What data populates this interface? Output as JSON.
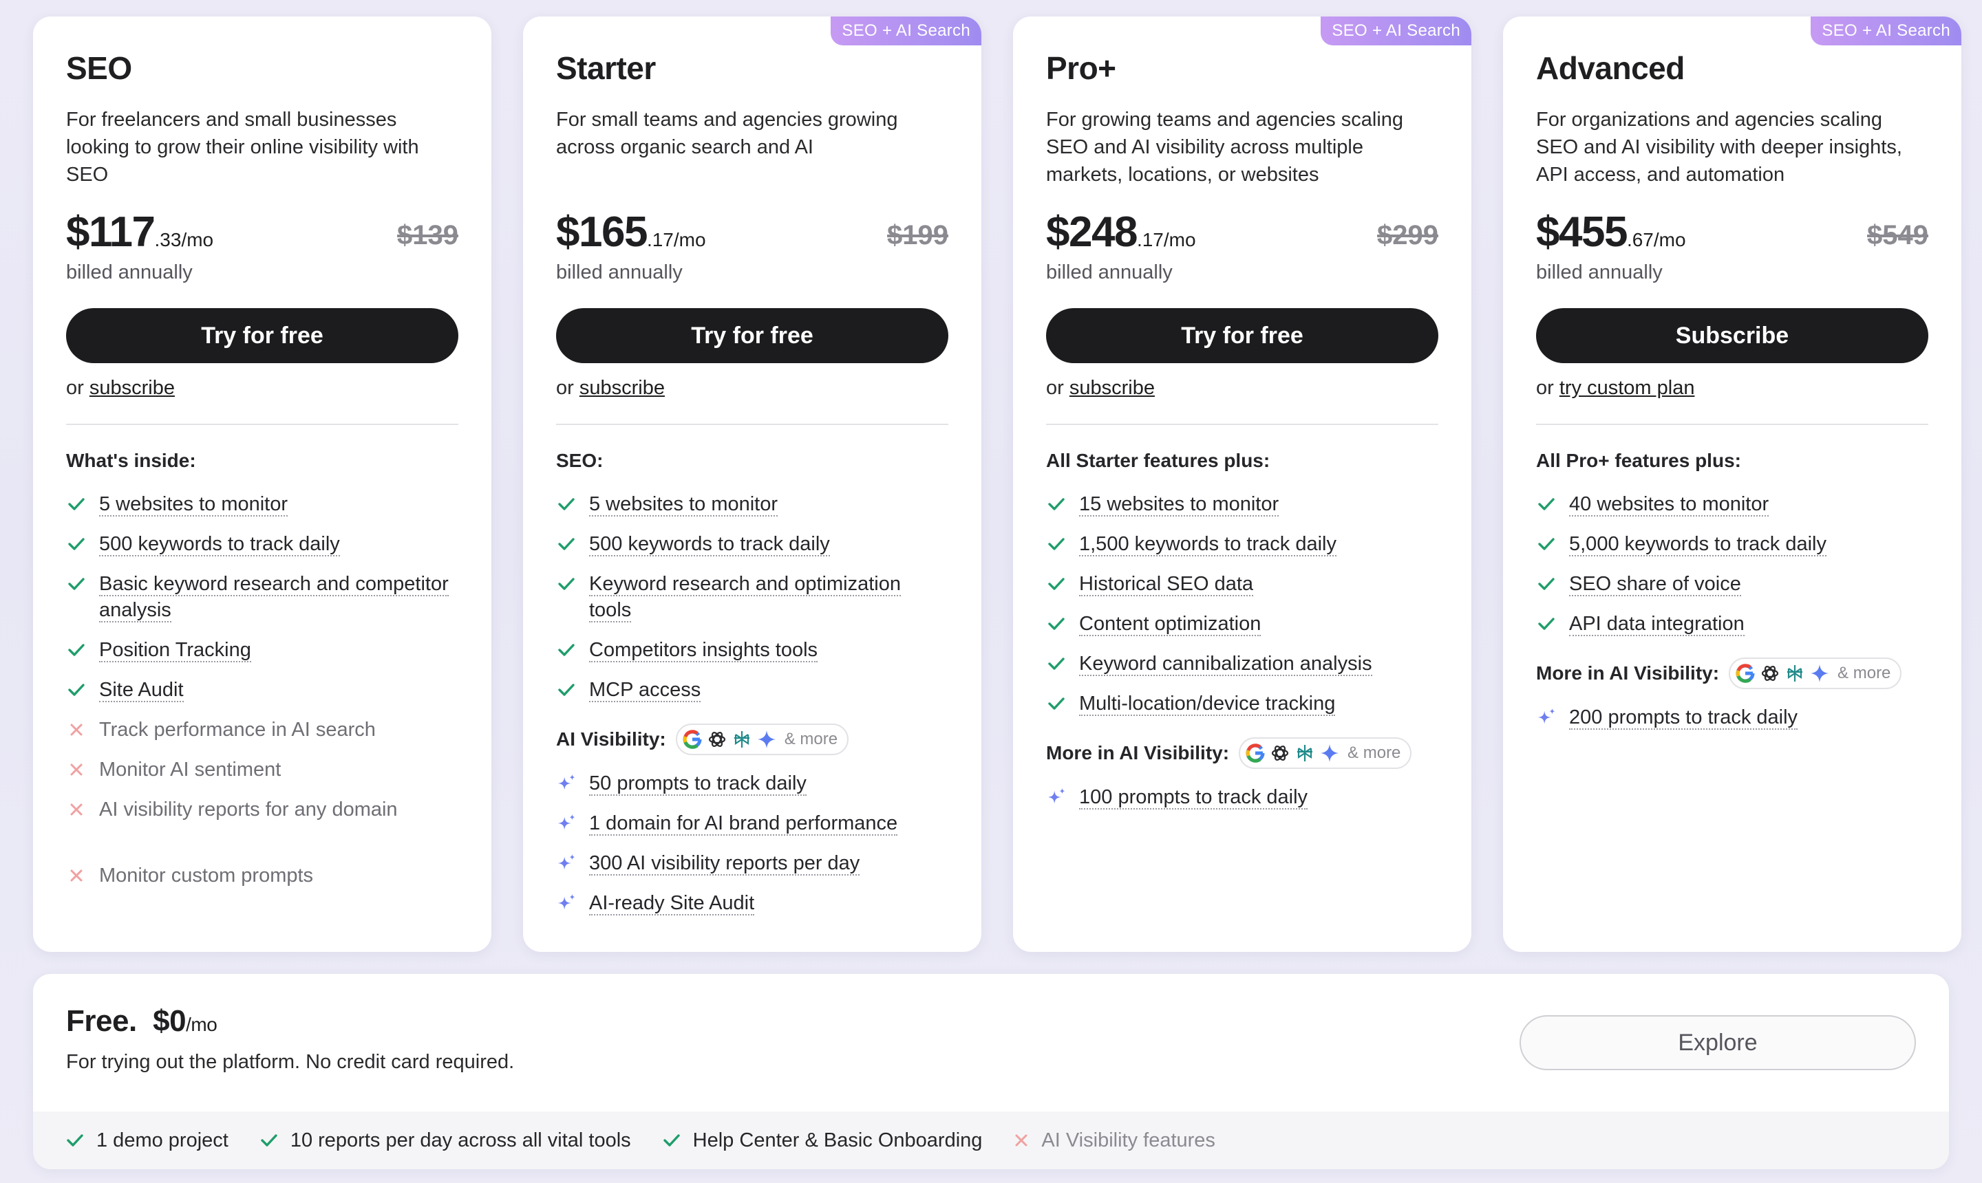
{
  "colors": {
    "check": "#1f9d6b",
    "cross": "#f0a1a1",
    "sparkle": "#6f7ff0",
    "cta": "#1c1c1e",
    "badge": "#b394f2"
  },
  "plans": [
    {
      "name": "SEO",
      "badge": "",
      "description": "For freelancers and small businesses looking to grow their online visibility with SEO",
      "price_main": "$117",
      "price_cents": ".33/mo",
      "old_price": "$139",
      "billed": "billed annually",
      "cta": "Try for free",
      "alt_prefix": "or ",
      "alt_link": "subscribe",
      "section": "What's inside:",
      "features": [
        {
          "text": "5 websites to monitor",
          "icon": "check"
        },
        {
          "text": "500 keywords to track daily",
          "icon": "check"
        },
        {
          "text": "Basic keyword research and competitor analysis",
          "icon": "check"
        },
        {
          "text": "Position Tracking",
          "icon": "check"
        },
        {
          "text": "Site Audit",
          "icon": "check"
        },
        {
          "text": "Track performance in AI search",
          "icon": "cross"
        },
        {
          "text": "Monitor AI sentiment",
          "icon": "cross"
        },
        {
          "text": "AI visibility reports for any domain",
          "icon": "cross"
        },
        {
          "text": "Monitor custom prompts",
          "icon": "cross"
        }
      ],
      "ai_label": "",
      "ai_features": []
    },
    {
      "name": "Starter",
      "badge": "SEO + AI Search",
      "description": "For small teams and agencies growing across organic search and AI",
      "price_main": "$165",
      "price_cents": ".17/mo",
      "old_price": "$199",
      "billed": "billed annually",
      "cta": "Try for free",
      "alt_prefix": "or ",
      "alt_link": "subscribe",
      "section": "SEO:",
      "features": [
        {
          "text": "5 websites to monitor",
          "icon": "check"
        },
        {
          "text": "500 keywords to track daily",
          "icon": "check"
        },
        {
          "text": "Keyword research and optimization tools",
          "icon": "check"
        },
        {
          "text": "Competitors insights tools",
          "icon": "check"
        },
        {
          "text": "MCP access",
          "icon": "check"
        }
      ],
      "ai_label": "AI Visibility:",
      "ai_features": [
        {
          "text": "50 prompts to track daily"
        },
        {
          "text": "1 domain for AI brand performance"
        },
        {
          "text": "300 AI visibility reports per day"
        },
        {
          "text": "AI-ready Site Audit"
        }
      ]
    },
    {
      "name": "Pro+",
      "badge": "SEO + AI Search",
      "description": "For growing teams and agencies scaling SEO and AI visibility across multiple markets, locations, or websites",
      "price_main": "$248",
      "price_cents": ".17/mo",
      "old_price": "$299",
      "billed": "billed annually",
      "cta": "Try for free",
      "alt_prefix": "or ",
      "alt_link": "subscribe",
      "section": "All Starter features plus:",
      "features": [
        {
          "text": "15 websites to monitor",
          "icon": "check"
        },
        {
          "text": "1,500 keywords to track daily",
          "icon": "check"
        },
        {
          "text": "Historical SEO data",
          "icon": "check"
        },
        {
          "text": "Content optimization",
          "icon": "check"
        },
        {
          "text": "Keyword cannibalization analysis",
          "icon": "check"
        },
        {
          "text": "Multi-location/device tracking",
          "icon": "check"
        }
      ],
      "ai_label": "More in AI Visibility:",
      "ai_features": [
        {
          "text": "100 prompts to track daily"
        }
      ]
    },
    {
      "name": "Advanced",
      "badge": "SEO + AI Search",
      "description": "For organizations and agencies scaling SEO and AI visibility with deeper insights, API access, and automation",
      "price_main": "$455",
      "price_cents": ".67/mo",
      "old_price": "$549",
      "billed": "billed annually",
      "cta": "Subscribe",
      "alt_prefix": "or ",
      "alt_link": "try custom plan",
      "section": "All Pro+ features plus:",
      "features": [
        {
          "text": "40 websites to monitor",
          "icon": "check"
        },
        {
          "text": "5,000 keywords to track daily",
          "icon": "check"
        },
        {
          "text": "SEO share of voice",
          "icon": "check"
        },
        {
          "text": "API data integration",
          "icon": "check"
        }
      ],
      "ai_label": "More in AI Visibility:",
      "ai_features": [
        {
          "text": "200 prompts to track daily"
        }
      ]
    }
  ],
  "ai_icons": [
    "google-icon",
    "openai-icon",
    "perplexity-icon",
    "gemini-icon"
  ],
  "ai_more": "& more",
  "free": {
    "title": "Free.",
    "price": "$0",
    "unit": "/mo",
    "description": "For trying out the platform. No credit card required.",
    "cta": "Explore",
    "features": [
      {
        "text": "1 demo project",
        "icon": "check"
      },
      {
        "text": "10 reports per day across all vital tools",
        "icon": "check"
      },
      {
        "text": "Help Center & Basic Onboarding",
        "icon": "check"
      },
      {
        "text": "AI Visibility features",
        "icon": "cross"
      }
    ]
  }
}
